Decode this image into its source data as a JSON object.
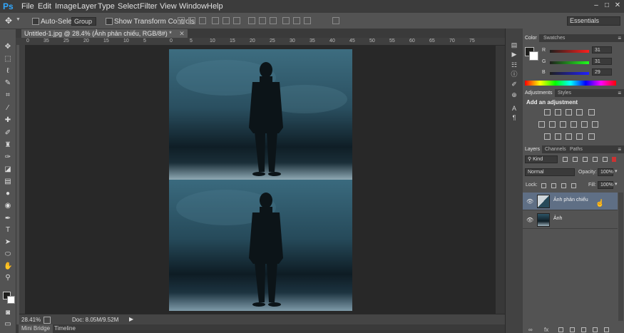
{
  "app": {
    "logo": "Ps"
  },
  "menu": [
    "File",
    "Edit",
    "Image",
    "Layer",
    "Type",
    "Select",
    "Filter",
    "View",
    "Window",
    "Help"
  ],
  "window_controls": {
    "minimize": "–",
    "maximize": "□",
    "close": "✕"
  },
  "options": {
    "auto_select_label": "Auto-Select:",
    "auto_select_value": "Group",
    "show_transform_label": "Show Transform Controls",
    "workspace": "Essentials"
  },
  "document": {
    "tab_title": "Untitled-1.jpg @ 28.4% (Ảnh phản chiếu, RGB/8#) *",
    "tab_close": "✕"
  },
  "ruler_ticks": [
    "0",
    "35",
    "25",
    "20",
    "15",
    "10",
    "5",
    "0",
    "5",
    "10",
    "15",
    "20",
    "25",
    "30",
    "35",
    "40",
    "45",
    "50",
    "55",
    "60",
    "65",
    "70",
    "75"
  ],
  "status": {
    "zoom": "28.41%",
    "doc_info": "Doc: 8.05M/9.52M"
  },
  "bottom_tabs": [
    "Mini Bridge",
    "Timeline"
  ],
  "color_panel": {
    "tabs": [
      "Color",
      "Swatches"
    ],
    "channels": [
      {
        "label": "R",
        "value": "31",
        "color": "#e02020"
      },
      {
        "label": "G",
        "value": "31",
        "color": "#20c020"
      },
      {
        "label": "B",
        "value": "29",
        "color": "#2050e0"
      }
    ]
  },
  "adjustments_panel": {
    "tabs": [
      "Adjustments",
      "Styles"
    ],
    "heading": "Add an adjustment"
  },
  "layers_panel": {
    "tabs": [
      "Layers",
      "Channels",
      "Paths"
    ],
    "kind": "Kind",
    "blend_mode": "Normal",
    "opacity_label": "Opacity:",
    "opacity_value": "100%",
    "lock_label": "Lock:",
    "fill_label": "Fill:",
    "fill_value": "100%",
    "layers": [
      {
        "name": "Ảnh phản chiếu",
        "selected": true
      },
      {
        "name": "Ảnh",
        "selected": false
      }
    ]
  },
  "colors": {
    "accent": "#31a8ff",
    "selected_layer": "#5f6f85"
  }
}
